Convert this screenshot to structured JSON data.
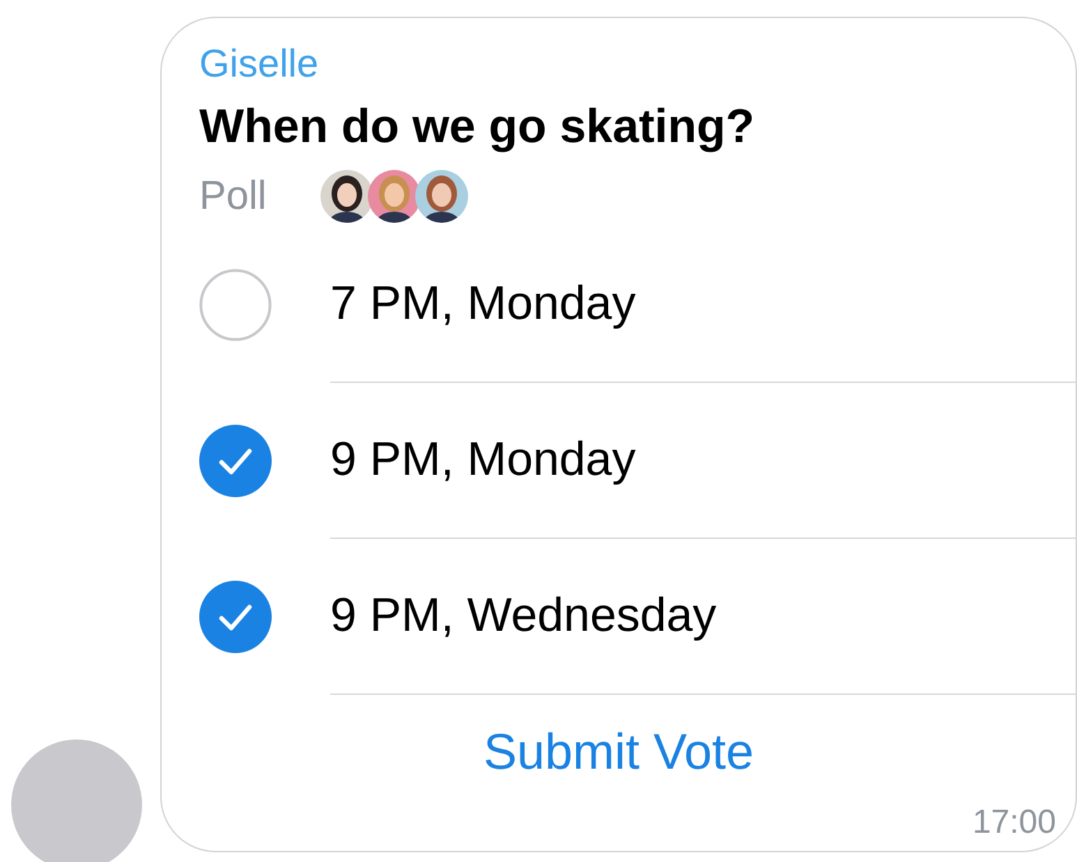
{
  "message": {
    "sender": "Giselle",
    "question": "When do we go skating?",
    "type_label": "Poll",
    "options": [
      {
        "label": "7 PM, Monday",
        "selected": false
      },
      {
        "label": "9 PM, Monday",
        "selected": true
      },
      {
        "label": "9 PM, Wednesday",
        "selected": true
      }
    ],
    "action": "Submit Vote",
    "time": "17:00"
  }
}
